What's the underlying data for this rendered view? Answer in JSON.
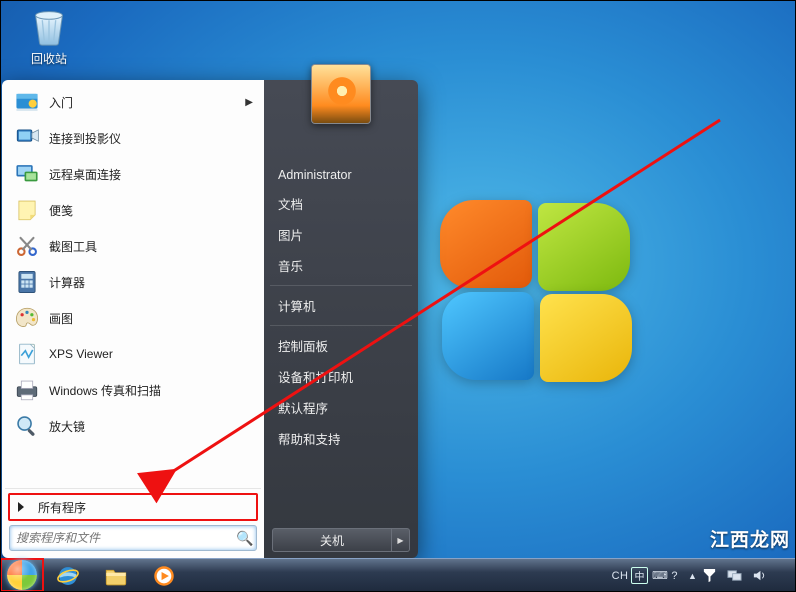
{
  "desktop": {
    "recycle_bin_label": "回收站"
  },
  "start_menu": {
    "programs": [
      {
        "id": "getting-started",
        "label": "入门",
        "has_submenu": true
      },
      {
        "id": "connect-projector",
        "label": "连接到投影仪",
        "has_submenu": false
      },
      {
        "id": "remote-desktop",
        "label": "远程桌面连接",
        "has_submenu": false
      },
      {
        "id": "sticky-notes",
        "label": "便笺",
        "has_submenu": false
      },
      {
        "id": "snipping-tool",
        "label": "截图工具",
        "has_submenu": false
      },
      {
        "id": "calculator",
        "label": "计算器",
        "has_submenu": false
      },
      {
        "id": "paint",
        "label": "画图",
        "has_submenu": false
      },
      {
        "id": "xps-viewer",
        "label": "XPS Viewer",
        "has_submenu": false
      },
      {
        "id": "fax-scan",
        "label": "Windows 传真和扫描",
        "has_submenu": false
      },
      {
        "id": "magnifier",
        "label": "放大镜",
        "has_submenu": false
      }
    ],
    "all_programs_label": "所有程序",
    "search_placeholder": "搜索程序和文件",
    "user_name": "Administrator",
    "right_links_top": [
      "文档",
      "图片",
      "音乐"
    ],
    "right_links_mid": [
      "计算机"
    ],
    "right_links_bot": [
      "控制面板",
      "设备和打印机",
      "默认程序",
      "帮助和支持"
    ],
    "shutdown_label": "关机"
  },
  "taskbar": {
    "pinned": [
      "internet-explorer",
      "file-explorer",
      "media-player"
    ],
    "tray": {
      "lang_primary": "CH",
      "lang_badge": "中",
      "time": "",
      "date": ""
    }
  },
  "watermark": "江西龙网"
}
